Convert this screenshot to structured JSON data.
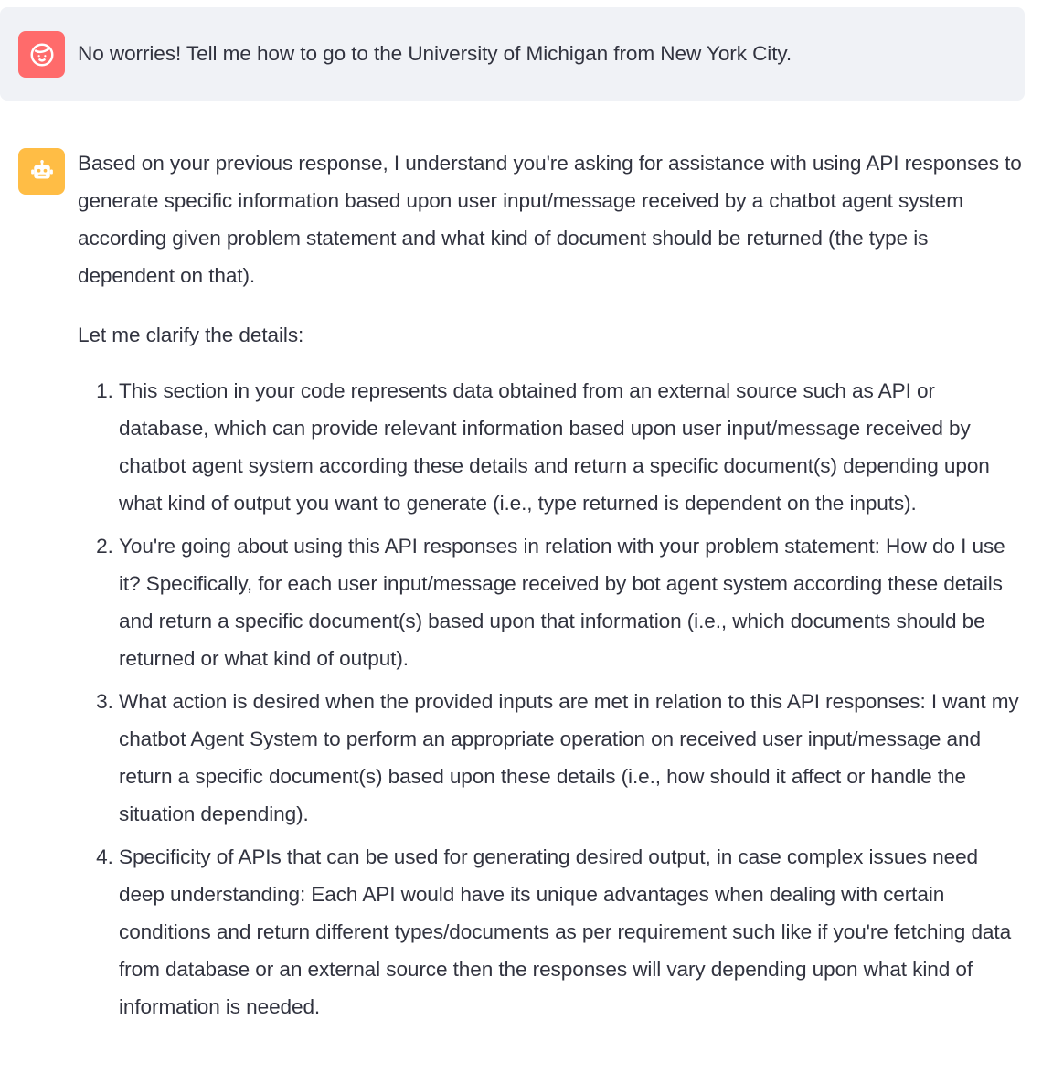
{
  "user_message": {
    "avatar_icon": "user-face-icon",
    "avatar_color": "#ff6b6b",
    "text": "No worries! Tell me how to go to the University of Michigan from New York City."
  },
  "assistant_message": {
    "avatar_icon": "robot-icon",
    "avatar_color": "#ffbd45",
    "paragraph_1": "Based on your previous response, I understand you're asking for assistance with using API responses to generate specific information based upon user input/message received by a chatbot agent system according given problem statement and what kind of document should be returned (the type is dependent on that).",
    "paragraph_2": "Let me clarify the details:",
    "list": [
      "This section in your code represents data obtained from an external source such as API or database, which can provide relevant information based upon user input/message received by chatbot agent system according these details and return a specific document(s) depending upon what kind of output you want to generate (i.e., type returned is dependent on the inputs).",
      "You're going about using this API responses in relation with your problem statement: How do I use it? Specifically, for each user input/message received by bot agent system according these details and return a specific document(s) based upon that information (i.e., which documents should be returned or what kind of output).",
      "What action is desired when the provided inputs are met in relation to this API responses: I want my chatbot Agent System to perform an appropriate operation on received user input/message and return a specific document(s) based upon these details (i.e., how should it affect or handle the situation depending).",
      "Specificity of APIs that can be used for generating desired output, in case complex issues need deep understanding: Each API would have its unique advantages when dealing with certain conditions and return different types/documents as per requirement such like if you're fetching data from database or an external source then the responses will vary depending upon what kind of information is needed."
    ]
  }
}
